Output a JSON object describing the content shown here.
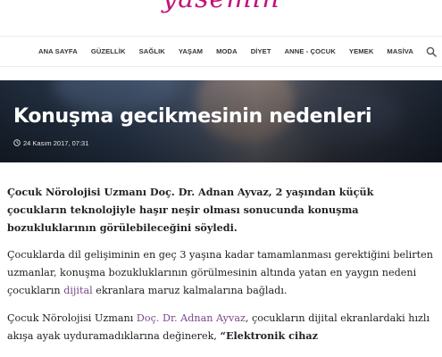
{
  "site": {
    "logo_text": "yasemin"
  },
  "nav": {
    "items": [
      "ANA SAYFA",
      "GÜZELLİK",
      "SAĞLIK",
      "YAŞAM",
      "MODA",
      "DİYET",
      "ANNE - ÇOCUK",
      "YEMEK",
      "MASİVA"
    ],
    "search_icon": "search-icon"
  },
  "article": {
    "title": "Konuşma gecikmesinin nedenleri",
    "date": "24 Kasım 2017, 07:31",
    "lead": "Çocuk Nörolojisi Uzmanı Doç. Dr. Adnan Ayvaz, 2 yaşından küçük çocukların teknolojiyle haşır neşir olması sonucunda konuşma bozukluklarının görülebileceğini söyledi.",
    "p2": {
      "t1": "Çocuklarda dil gelişiminin en geç 3 yaşına kadar tamamlanması gerektiğini belirten uzmanlar, konuşma bozukluklarının görülmesinin altında yatan en yaygın nedeni çocukların ",
      "link": "dijital",
      "t2": " ekranlara maruz kalmalarına bağladı."
    },
    "p3": {
      "t1": "Çocuk Nörolojisi Uzmanı ",
      "link": "Doç. Dr. Adnan Ayvaz",
      "t2": ", çocukların dijital ekranlardaki hızlı akışa ayak uyduramadıklarına değinerek, ",
      "quote": "“Elektronik cihaz"
    }
  },
  "colors": {
    "brand": "#c2127b",
    "link": "#7a4a8a"
  }
}
